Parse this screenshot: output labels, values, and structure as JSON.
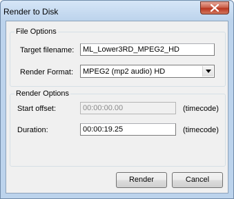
{
  "window": {
    "title": "Render to Disk"
  },
  "file_options": {
    "legend": "File Options",
    "target_filename_label": "Target filename:",
    "target_filename_value": "ML_Lower3RD_MPEG2_HD",
    "render_format_label": "Render Format:",
    "render_format_value": "MPEG2 (mp2 audio) HD"
  },
  "render_options": {
    "legend": "Render Options",
    "start_offset_label": "Start offset:",
    "start_offset_value": "00:00:00.00",
    "start_offset_unit": "(timecode)",
    "duration_label": "Duration:",
    "duration_value": "00:00:19.25",
    "duration_unit": "(timecode)"
  },
  "buttons": {
    "render": "Render",
    "cancel": "Cancel"
  },
  "icons": {
    "close": "close-icon",
    "dropdown": "chevron-down-icon"
  }
}
